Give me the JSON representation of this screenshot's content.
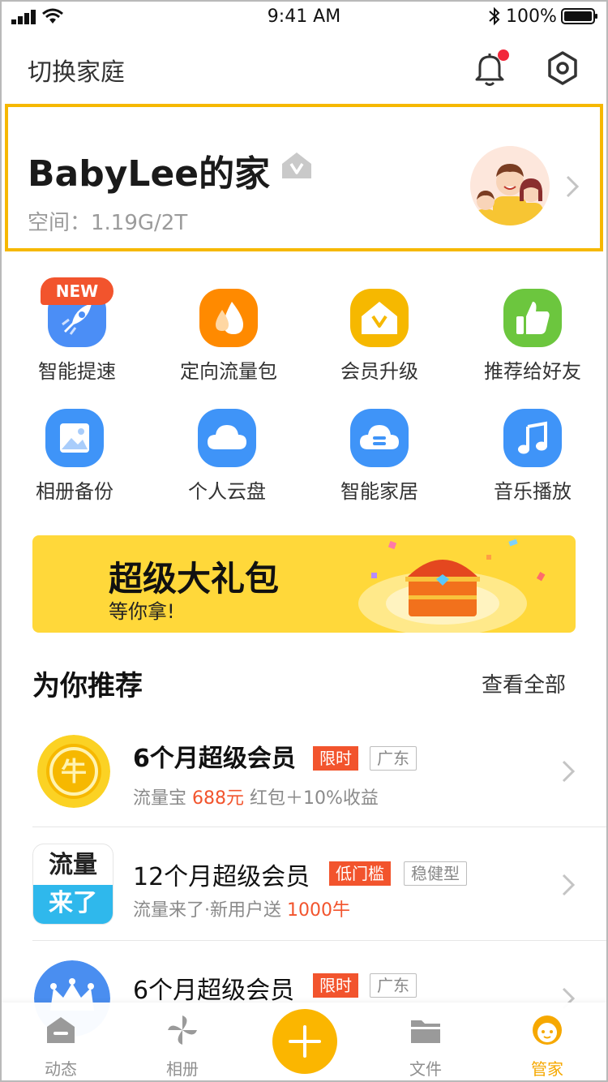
{
  "status_bar": {
    "time": "9:41 AM",
    "battery_percent": "100%"
  },
  "header": {
    "title": "切换家庭",
    "icons": [
      "bell-icon",
      "settings-icon"
    ],
    "notification_dot_color": "#f2273a"
  },
  "family_card": {
    "name": "BabyLee的家",
    "storage": "空间：1.19G/2T",
    "highlight_color": "#f6b800"
  },
  "features": [
    {
      "label": "智能提速",
      "icon": "rocket-icon",
      "color": "#4b8ef6",
      "badge": "NEW"
    },
    {
      "label": "定向流量包",
      "icon": "drops-icon",
      "color": "#ff8a00"
    },
    {
      "label": "会员升级",
      "icon": "vip-house-icon",
      "color": "#f6b800"
    },
    {
      "label": "推荐给好友",
      "icon": "thumbs-up-icon",
      "color": "#6cc63e"
    },
    {
      "label": "相册备份",
      "icon": "photo-icon",
      "color": "#3f94f8"
    },
    {
      "label": "个人云盘",
      "icon": "cloud-icon",
      "color": "#3f94f8"
    },
    {
      "label": "智能家居",
      "icon": "smart-home-cloud-icon",
      "color": "#3f94f8"
    },
    {
      "label": "音乐播放",
      "icon": "music-note-icon",
      "color": "#3f94f8"
    }
  ],
  "banner": {
    "title": "超级大礼包",
    "subtitle": "等你拿!",
    "background": "#ffd83a"
  },
  "recommend": {
    "title": "为你推荐",
    "more": "查看全部",
    "items": [
      {
        "name": "6个月超级会员",
        "tag_primary": "限时",
        "tag_secondary": "广东",
        "desc_prefix": "流量宝 ",
        "desc_highlight": "688元",
        "desc_suffix": " 红包＋10%收益",
        "image": "coin-icon"
      },
      {
        "name": "12个月超级会员",
        "tag_primary": "低门槛",
        "tag_secondary": "稳健型",
        "desc_prefix": "流量来了·新用户送 ",
        "desc_highlight": "1000牛",
        "desc_suffix": "",
        "image_text_top": "流量",
        "image_text_bottom": "来了"
      },
      {
        "name": "6个月超级会员",
        "tag_primary": "限时",
        "tag_secondary": "广东",
        "image": "crown-icon"
      }
    ]
  },
  "tabbar": {
    "tabs": [
      {
        "label": "动态",
        "icon": "feed-icon"
      },
      {
        "label": "相册",
        "icon": "pinwheel-icon"
      },
      {
        "label": "",
        "icon": "plus-icon"
      },
      {
        "label": "文件",
        "icon": "folder-icon"
      },
      {
        "label": "管家",
        "icon": "butler-icon",
        "active": true
      }
    ],
    "accent": "#f6a800"
  }
}
